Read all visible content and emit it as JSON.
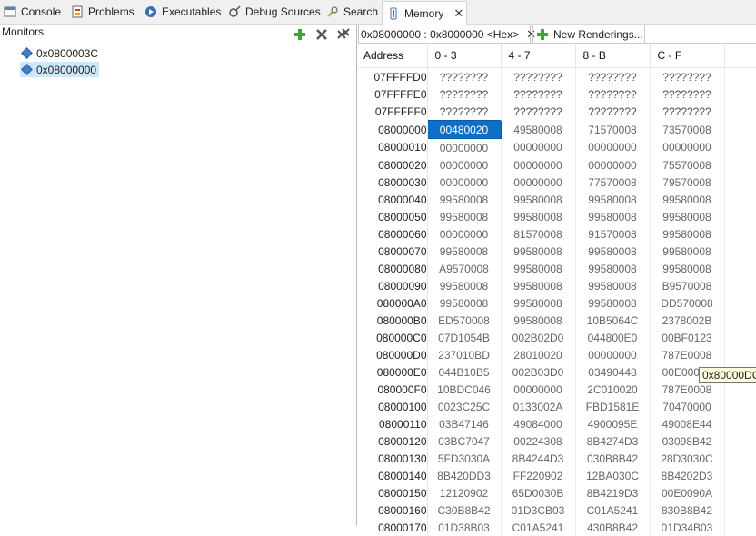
{
  "tabs": [
    {
      "label": "Console",
      "icon": "console-icon"
    },
    {
      "label": "Problems",
      "icon": "problems-icon"
    },
    {
      "label": "Executables",
      "icon": "executables-icon"
    },
    {
      "label": "Debug Sources",
      "icon": "debug-sources-icon"
    },
    {
      "label": "Search",
      "icon": "search-icon"
    },
    {
      "label": "Memory",
      "icon": "memory-icon",
      "active": true
    }
  ],
  "monitors": {
    "title": "Monitors",
    "items": [
      {
        "label": "0x0800003C",
        "selected": false
      },
      {
        "label": "0x08000000",
        "selected": true
      }
    ]
  },
  "rendering_tabs": {
    "current": "0x08000000 : 0x8000000 <Hex>",
    "new": "New Renderings..."
  },
  "memory": {
    "headers": [
      "Address",
      "0 - 3",
      "4 - 7",
      "8 - B",
      "C - F"
    ],
    "rows": [
      [
        "07FFFFD0",
        "????????",
        "????????",
        "????????",
        "????????"
      ],
      [
        "07FFFFE0",
        "????????",
        "????????",
        "????????",
        "????????"
      ],
      [
        "07FFFFF0",
        "????????",
        "????????",
        "????????",
        "????????"
      ],
      [
        "08000000",
        "00480020",
        "49580008",
        "71570008",
        "73570008"
      ],
      [
        "08000010",
        "00000000",
        "00000000",
        "00000000",
        "00000000"
      ],
      [
        "08000020",
        "00000000",
        "00000000",
        "00000000",
        "75570008"
      ],
      [
        "08000030",
        "00000000",
        "00000000",
        "77570008",
        "79570008"
      ],
      [
        "08000040",
        "99580008",
        "99580008",
        "99580008",
        "99580008"
      ],
      [
        "08000050",
        "99580008",
        "99580008",
        "99580008",
        "99580008"
      ],
      [
        "08000060",
        "00000000",
        "81570008",
        "91570008",
        "99580008"
      ],
      [
        "08000070",
        "99580008",
        "99580008",
        "99580008",
        "99580008"
      ],
      [
        "08000080",
        "A9570008",
        "99580008",
        "99580008",
        "99580008"
      ],
      [
        "08000090",
        "99580008",
        "99580008",
        "99580008",
        "B9570008"
      ],
      [
        "080000A0",
        "99580008",
        "99580008",
        "99580008",
        "DD570008"
      ],
      [
        "080000B0",
        "ED570008",
        "99580008",
        "10B5064C",
        "2378002B"
      ],
      [
        "080000C0",
        "07D1054B",
        "002B02D0",
        "044800E0",
        "00BF0123"
      ],
      [
        "080000D0",
        "237010BD",
        "28010020",
        "00000000",
        "787E0008"
      ],
      [
        "080000E0",
        "044B10B5",
        "002B03D0",
        "03490448",
        "00E00008"
      ],
      [
        "080000F0",
        "10BDC046",
        "00000000",
        "2C010020",
        "787E0008"
      ],
      [
        "08000100",
        "0023C25C",
        "0133002A",
        "FBD1581E",
        "70470000"
      ],
      [
        "08000110",
        "03B47146",
        "49084000",
        "4900095E",
        "49008E44"
      ],
      [
        "08000120",
        "03BC7047",
        "00224308",
        "8B4274D3",
        "03098B42"
      ],
      [
        "08000130",
        "5FD3030A",
        "8B4244D3",
        "030B8B42",
        "28D3030C"
      ],
      [
        "08000140",
        "8B420DD3",
        "FF220902",
        "12BA030C",
        "8B4202D3"
      ],
      [
        "08000150",
        "12120902",
        "65D0030B",
        "8B4219D3",
        "00E0090A"
      ],
      [
        "08000160",
        "C30B8B42",
        "01D3CB03",
        "C01A5241",
        "830B8B42"
      ],
      [
        "08000170",
        "01D38B03",
        "C01A5241",
        "430B8B42",
        "01D34B03"
      ]
    ],
    "highlight": {
      "row": 3,
      "col": 1
    }
  },
  "tooltip": "0x80000DC",
  "colors": {
    "highlight": "#0f6fc6",
    "selection": "#cce8ff",
    "tooltip_bg": "#ffffe1"
  }
}
